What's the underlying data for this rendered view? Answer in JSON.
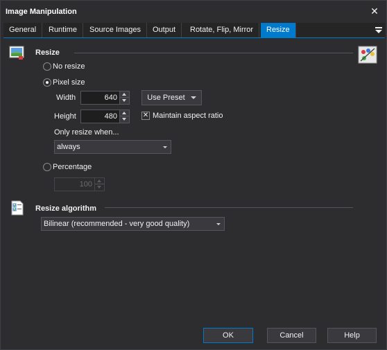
{
  "window": {
    "title": "Image Manipulation"
  },
  "tabs": [
    {
      "label": "General"
    },
    {
      "label": "Runtime"
    },
    {
      "label": "Source Images"
    },
    {
      "label": "Output"
    },
    {
      "label": "Rotate, Flip, Mirror"
    },
    {
      "label": "Resize"
    }
  ],
  "active_tab": "Resize",
  "resize": {
    "section_title": "Resize",
    "no_resize_label": "No resize",
    "pixel_size_label": "Pixel size",
    "width_label": "Width",
    "width_value": "640",
    "height_label": "Height",
    "height_value": "480",
    "use_preset_label": "Use Preset",
    "maintain_aspect_label": "Maintain aspect ratio",
    "maintain_aspect_checked": true,
    "only_resize_label": "Only resize when...",
    "only_resize_value": "always",
    "percentage_label": "Percentage",
    "percentage_value": "100",
    "selected_mode": "Pixel size"
  },
  "algorithm": {
    "section_title": "Resize algorithm",
    "value": "Bilinear (recommended - very good quality)"
  },
  "buttons": {
    "ok": "OK",
    "cancel": "Cancel",
    "help": "Help"
  },
  "colors": {
    "accent": "#007acc",
    "background": "#2d2d30"
  }
}
